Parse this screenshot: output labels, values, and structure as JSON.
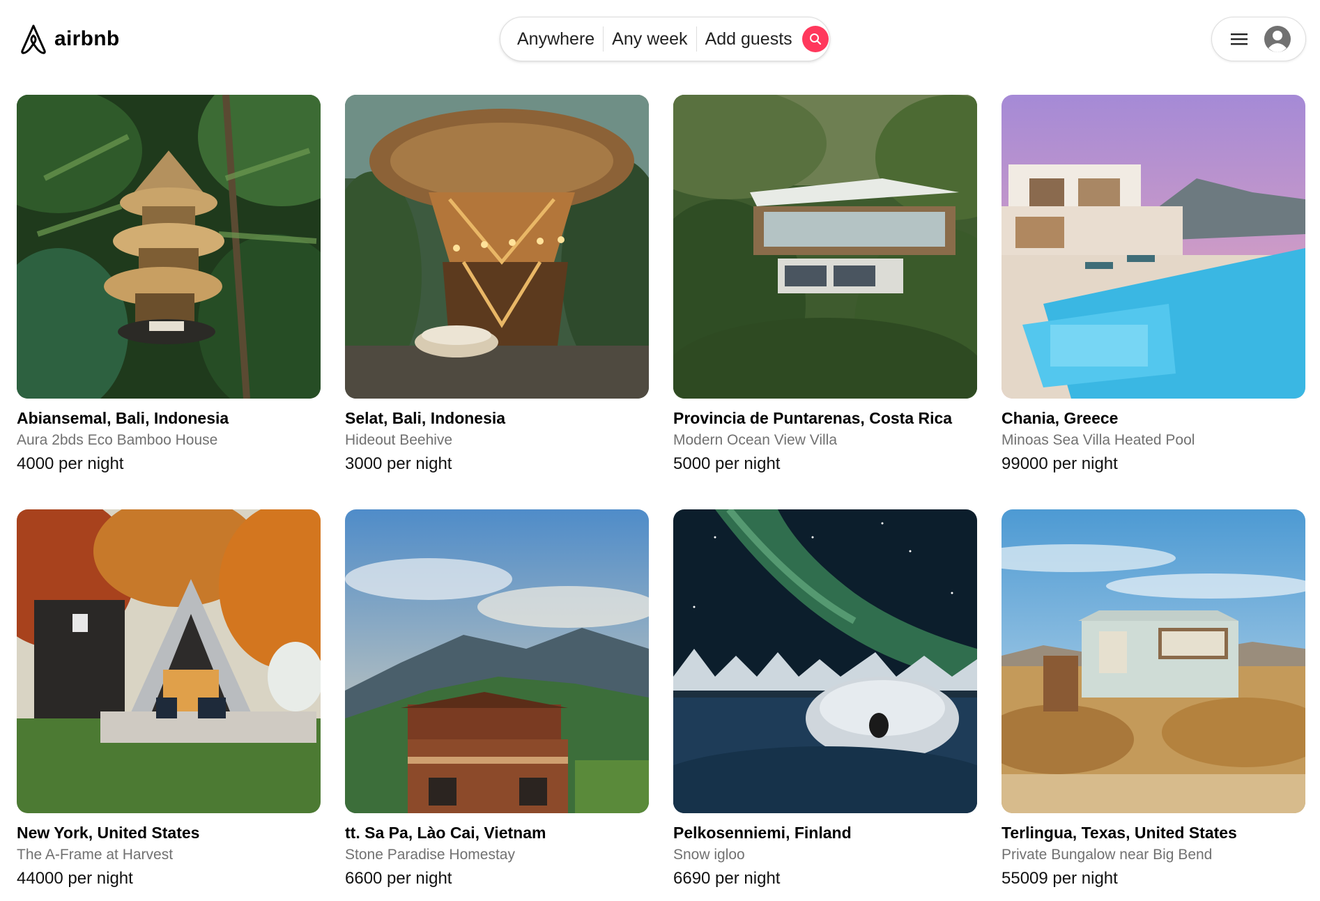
{
  "brand": {
    "name": "airbnb",
    "logo_icon": "airbnb-logo-icon",
    "accent": "#ff385c"
  },
  "search": {
    "location": "Anywhere",
    "dates": "Any week",
    "guests": "Add guests",
    "icon": "search-icon"
  },
  "user_menu": {
    "menu_icon": "hamburger-icon",
    "avatar_icon": "user-avatar-icon"
  },
  "listings": [
    {
      "location": "Abiansemal, Bali, Indonesia",
      "title": "Aura 2bds Eco Bamboo House",
      "price": "4000 per night",
      "photo": "bamboo-treehouse-jungle"
    },
    {
      "location": "Selat, Bali, Indonesia",
      "title": "Hideout Beehive",
      "price": "3000 per night",
      "photo": "bamboo-dome-lights"
    },
    {
      "location": "Provincia de Puntarenas, Costa Rica",
      "title": "Modern Ocean View Villa",
      "price": "5000 per night",
      "photo": "modern-villa-forest"
    },
    {
      "location": "Chania, Greece",
      "title": "Minoas Sea Villa Heated Pool",
      "price": "99000 per night",
      "photo": "white-villa-pool-sunset"
    },
    {
      "location": "New York, United States",
      "title": "The A-Frame at Harvest",
      "price": "44000 per night",
      "photo": "a-frame-cabin-autumn"
    },
    {
      "location": "tt. Sa Pa, Lào Cai, Vietnam",
      "title": "Stone Paradise Homestay",
      "price": "6600 per night",
      "photo": "homestay-mountains"
    },
    {
      "location": "Pelkosenniemi, Finland",
      "title": "Snow igloo",
      "price": "6690 per night",
      "photo": "igloo-aurora-night"
    },
    {
      "location": "Terlingua, Texas, United States",
      "title": "Private Bungalow near Big Bend",
      "price": "55009 per night",
      "photo": "desert-bungalow"
    }
  ]
}
